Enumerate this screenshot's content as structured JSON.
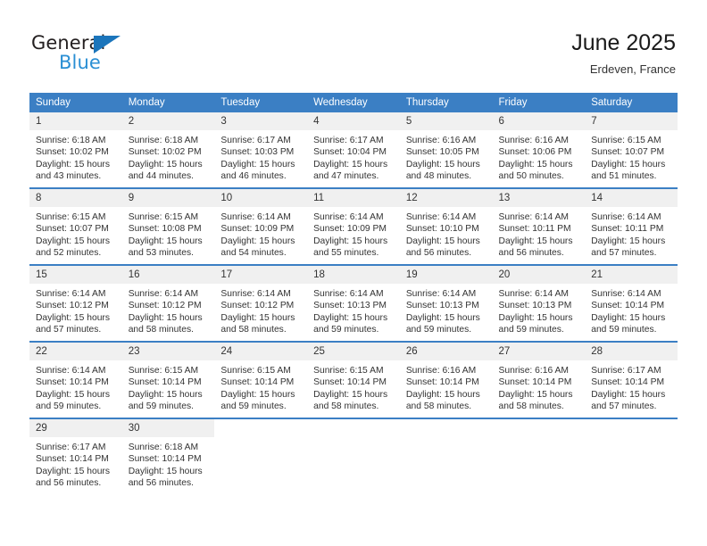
{
  "brand": {
    "name_line1": "General",
    "name_line2": "Blue",
    "triangle_icon": "triangle-icon",
    "accent_color": "#1b75bb",
    "blue_text_color": "#2a8fd4"
  },
  "header": {
    "title": "June 2025",
    "subtitle": "Erdeven, France"
  },
  "theme": {
    "header_row_color": "#3b7fc4",
    "daynum_band_color": "#f0f0f0",
    "week_separator_color": "#3b7fc4",
    "text_color": "#333333"
  },
  "columns": [
    "Sunday",
    "Monday",
    "Tuesday",
    "Wednesday",
    "Thursday",
    "Friday",
    "Saturday"
  ],
  "weeks": [
    [
      {
        "day": "1",
        "sunrise": "Sunrise: 6:18 AM",
        "sunset": "Sunset: 10:02 PM",
        "daylight": "Daylight: 15 hours and 43 minutes."
      },
      {
        "day": "2",
        "sunrise": "Sunrise: 6:18 AM",
        "sunset": "Sunset: 10:02 PM",
        "daylight": "Daylight: 15 hours and 44 minutes."
      },
      {
        "day": "3",
        "sunrise": "Sunrise: 6:17 AM",
        "sunset": "Sunset: 10:03 PM",
        "daylight": "Daylight: 15 hours and 46 minutes."
      },
      {
        "day": "4",
        "sunrise": "Sunrise: 6:17 AM",
        "sunset": "Sunset: 10:04 PM",
        "daylight": "Daylight: 15 hours and 47 minutes."
      },
      {
        "day": "5",
        "sunrise": "Sunrise: 6:16 AM",
        "sunset": "Sunset: 10:05 PM",
        "daylight": "Daylight: 15 hours and 48 minutes."
      },
      {
        "day": "6",
        "sunrise": "Sunrise: 6:16 AM",
        "sunset": "Sunset: 10:06 PM",
        "daylight": "Daylight: 15 hours and 50 minutes."
      },
      {
        "day": "7",
        "sunrise": "Sunrise: 6:15 AM",
        "sunset": "Sunset: 10:07 PM",
        "daylight": "Daylight: 15 hours and 51 minutes."
      }
    ],
    [
      {
        "day": "8",
        "sunrise": "Sunrise: 6:15 AM",
        "sunset": "Sunset: 10:07 PM",
        "daylight": "Daylight: 15 hours and 52 minutes."
      },
      {
        "day": "9",
        "sunrise": "Sunrise: 6:15 AM",
        "sunset": "Sunset: 10:08 PM",
        "daylight": "Daylight: 15 hours and 53 minutes."
      },
      {
        "day": "10",
        "sunrise": "Sunrise: 6:14 AM",
        "sunset": "Sunset: 10:09 PM",
        "daylight": "Daylight: 15 hours and 54 minutes."
      },
      {
        "day": "11",
        "sunrise": "Sunrise: 6:14 AM",
        "sunset": "Sunset: 10:09 PM",
        "daylight": "Daylight: 15 hours and 55 minutes."
      },
      {
        "day": "12",
        "sunrise": "Sunrise: 6:14 AM",
        "sunset": "Sunset: 10:10 PM",
        "daylight": "Daylight: 15 hours and 56 minutes."
      },
      {
        "day": "13",
        "sunrise": "Sunrise: 6:14 AM",
        "sunset": "Sunset: 10:11 PM",
        "daylight": "Daylight: 15 hours and 56 minutes."
      },
      {
        "day": "14",
        "sunrise": "Sunrise: 6:14 AM",
        "sunset": "Sunset: 10:11 PM",
        "daylight": "Daylight: 15 hours and 57 minutes."
      }
    ],
    [
      {
        "day": "15",
        "sunrise": "Sunrise: 6:14 AM",
        "sunset": "Sunset: 10:12 PM",
        "daylight": "Daylight: 15 hours and 57 minutes."
      },
      {
        "day": "16",
        "sunrise": "Sunrise: 6:14 AM",
        "sunset": "Sunset: 10:12 PM",
        "daylight": "Daylight: 15 hours and 58 minutes."
      },
      {
        "day": "17",
        "sunrise": "Sunrise: 6:14 AM",
        "sunset": "Sunset: 10:12 PM",
        "daylight": "Daylight: 15 hours and 58 minutes."
      },
      {
        "day": "18",
        "sunrise": "Sunrise: 6:14 AM",
        "sunset": "Sunset: 10:13 PM",
        "daylight": "Daylight: 15 hours and 59 minutes."
      },
      {
        "day": "19",
        "sunrise": "Sunrise: 6:14 AM",
        "sunset": "Sunset: 10:13 PM",
        "daylight": "Daylight: 15 hours and 59 minutes."
      },
      {
        "day": "20",
        "sunrise": "Sunrise: 6:14 AM",
        "sunset": "Sunset: 10:13 PM",
        "daylight": "Daylight: 15 hours and 59 minutes."
      },
      {
        "day": "21",
        "sunrise": "Sunrise: 6:14 AM",
        "sunset": "Sunset: 10:14 PM",
        "daylight": "Daylight: 15 hours and 59 minutes."
      }
    ],
    [
      {
        "day": "22",
        "sunrise": "Sunrise: 6:14 AM",
        "sunset": "Sunset: 10:14 PM",
        "daylight": "Daylight: 15 hours and 59 minutes."
      },
      {
        "day": "23",
        "sunrise": "Sunrise: 6:15 AM",
        "sunset": "Sunset: 10:14 PM",
        "daylight": "Daylight: 15 hours and 59 minutes."
      },
      {
        "day": "24",
        "sunrise": "Sunrise: 6:15 AM",
        "sunset": "Sunset: 10:14 PM",
        "daylight": "Daylight: 15 hours and 59 minutes."
      },
      {
        "day": "25",
        "sunrise": "Sunrise: 6:15 AM",
        "sunset": "Sunset: 10:14 PM",
        "daylight": "Daylight: 15 hours and 58 minutes."
      },
      {
        "day": "26",
        "sunrise": "Sunrise: 6:16 AM",
        "sunset": "Sunset: 10:14 PM",
        "daylight": "Daylight: 15 hours and 58 minutes."
      },
      {
        "day": "27",
        "sunrise": "Sunrise: 6:16 AM",
        "sunset": "Sunset: 10:14 PM",
        "daylight": "Daylight: 15 hours and 58 minutes."
      },
      {
        "day": "28",
        "sunrise": "Sunrise: 6:17 AM",
        "sunset": "Sunset: 10:14 PM",
        "daylight": "Daylight: 15 hours and 57 minutes."
      }
    ],
    [
      {
        "day": "29",
        "sunrise": "Sunrise: 6:17 AM",
        "sunset": "Sunset: 10:14 PM",
        "daylight": "Daylight: 15 hours and 56 minutes."
      },
      {
        "day": "30",
        "sunrise": "Sunrise: 6:18 AM",
        "sunset": "Sunset: 10:14 PM",
        "daylight": "Daylight: 15 hours and 56 minutes."
      },
      {
        "day": "",
        "sunrise": "",
        "sunset": "",
        "daylight": ""
      },
      {
        "day": "",
        "sunrise": "",
        "sunset": "",
        "daylight": ""
      },
      {
        "day": "",
        "sunrise": "",
        "sunset": "",
        "daylight": ""
      },
      {
        "day": "",
        "sunrise": "",
        "sunset": "",
        "daylight": ""
      },
      {
        "day": "",
        "sunrise": "",
        "sunset": "",
        "daylight": ""
      }
    ]
  ]
}
